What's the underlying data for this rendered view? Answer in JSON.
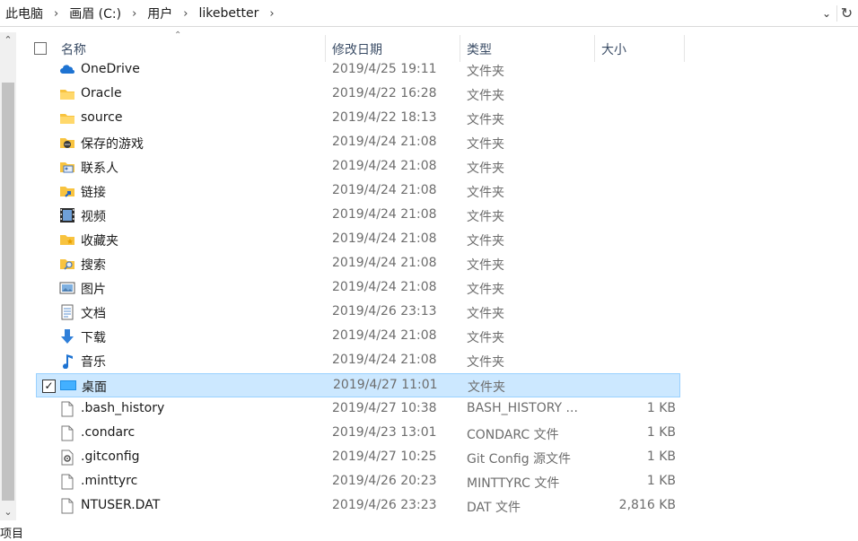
{
  "breadcrumb": [
    "此电脑",
    "画眉 (C:)",
    "用户",
    "likebetter"
  ],
  "columns": {
    "name": "名称",
    "date": "修改日期",
    "type": "类型",
    "size": "大小"
  },
  "rows": [
    {
      "name": "OneDrive",
      "date": "2019/4/25 19:11",
      "type": "文件夹",
      "size": "",
      "icon": "onedrive-icon"
    },
    {
      "name": "Oracle",
      "date": "2019/4/22 16:28",
      "type": "文件夹",
      "size": "",
      "icon": "folder-icon"
    },
    {
      "name": "source",
      "date": "2019/4/22 18:13",
      "type": "文件夹",
      "size": "",
      "icon": "folder-icon"
    },
    {
      "name": "保存的游戏",
      "date": "2019/4/24 21:08",
      "type": "文件夹",
      "size": "",
      "icon": "saved-games-icon"
    },
    {
      "name": "联系人",
      "date": "2019/4/24 21:08",
      "type": "文件夹",
      "size": "",
      "icon": "contacts-icon"
    },
    {
      "name": "链接",
      "date": "2019/4/24 21:08",
      "type": "文件夹",
      "size": "",
      "icon": "links-icon"
    },
    {
      "name": "视频",
      "date": "2019/4/24 21:08",
      "type": "文件夹",
      "size": "",
      "icon": "videos-icon"
    },
    {
      "name": "收藏夹",
      "date": "2019/4/24 21:08",
      "type": "文件夹",
      "size": "",
      "icon": "favorites-icon"
    },
    {
      "name": "搜索",
      "date": "2019/4/24 21:08",
      "type": "文件夹",
      "size": "",
      "icon": "searches-icon"
    },
    {
      "name": "图片",
      "date": "2019/4/24 21:08",
      "type": "文件夹",
      "size": "",
      "icon": "pictures-icon"
    },
    {
      "name": "文档",
      "date": "2019/4/26 23:13",
      "type": "文件夹",
      "size": "",
      "icon": "documents-icon"
    },
    {
      "name": "下载",
      "date": "2019/4/24 21:08",
      "type": "文件夹",
      "size": "",
      "icon": "downloads-icon"
    },
    {
      "name": "音乐",
      "date": "2019/4/24 21:08",
      "type": "文件夹",
      "size": "",
      "icon": "music-icon"
    },
    {
      "name": "桌面",
      "date": "2019/4/27 11:01",
      "type": "文件夹",
      "size": "",
      "icon": "desktop-icon",
      "selected": true
    },
    {
      "name": ".bash_history",
      "date": "2019/4/27 10:38",
      "type": "BASH_HISTORY ...",
      "size": "1 KB",
      "icon": "file-icon"
    },
    {
      "name": ".condarc",
      "date": "2019/4/23 13:01",
      "type": "CONDARC 文件",
      "size": "1 KB",
      "icon": "file-icon"
    },
    {
      "name": ".gitconfig",
      "date": "2019/4/27 10:25",
      "type": "Git Config 源文件",
      "size": "1 KB",
      "icon": "gear-file-icon"
    },
    {
      "name": ".minttyrc",
      "date": "2019/4/26 20:23",
      "type": "MINTTYRC 文件",
      "size": "1 KB",
      "icon": "file-icon"
    },
    {
      "name": "NTUSER.DAT",
      "date": "2019/4/26 23:23",
      "type": "DAT 文件",
      "size": "2,816 KB",
      "icon": "file-icon"
    }
  ],
  "status": {
    "text": "项目"
  },
  "colors": {
    "selection": "#cce8ff",
    "selection_border": "#99d1ff",
    "folder": "#f8c33f"
  }
}
